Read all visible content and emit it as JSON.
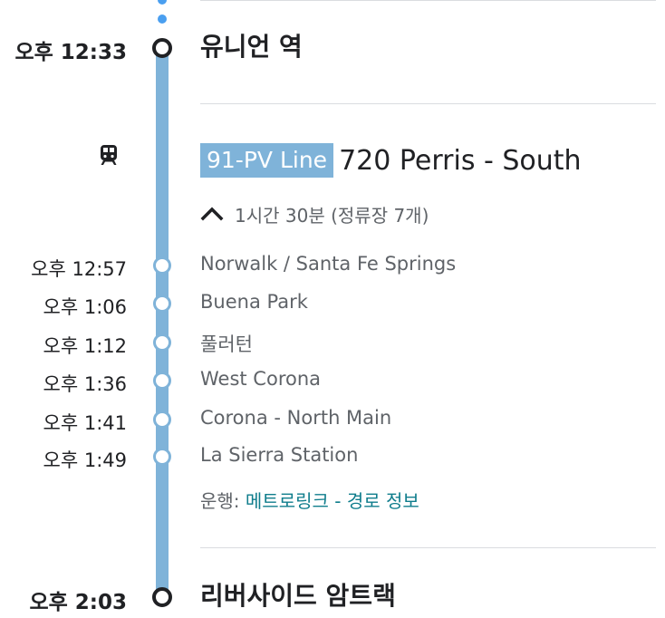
{
  "colors": {
    "line": "#7fb3d9",
    "walk_dots": "#4a9ff0",
    "link": "#0f7d8c",
    "text_primary": "#202124",
    "text_secondary": "#5f6368"
  },
  "departure": {
    "time": "오후 12:33",
    "name": "유니언 역"
  },
  "route": {
    "icon": "train-icon",
    "badge": "91-PV Line",
    "title": "720 Perris - South"
  },
  "stops_toggle": {
    "icon": "chevron-up-icon",
    "text": "1시간 30분 (정류장 7개)"
  },
  "stops": [
    {
      "time": "오후 12:57",
      "name": "Norwalk / Santa Fe Springs"
    },
    {
      "time": "오후 1:06",
      "name": "Buena Park"
    },
    {
      "time": "오후 1:12",
      "name": "풀러턴"
    },
    {
      "time": "오후 1:36",
      "name": "West Corona"
    },
    {
      "time": "오후 1:41",
      "name": "Corona - North Main"
    },
    {
      "time": "오후 1:49",
      "name": "La Sierra Station"
    }
  ],
  "operator": {
    "label": "운행: ",
    "name": "메트로링크",
    "separator": " - ",
    "details_link": "경로 정보"
  },
  "arrival": {
    "time": "오후 2:03",
    "name": "리버사이드 암트랙"
  }
}
